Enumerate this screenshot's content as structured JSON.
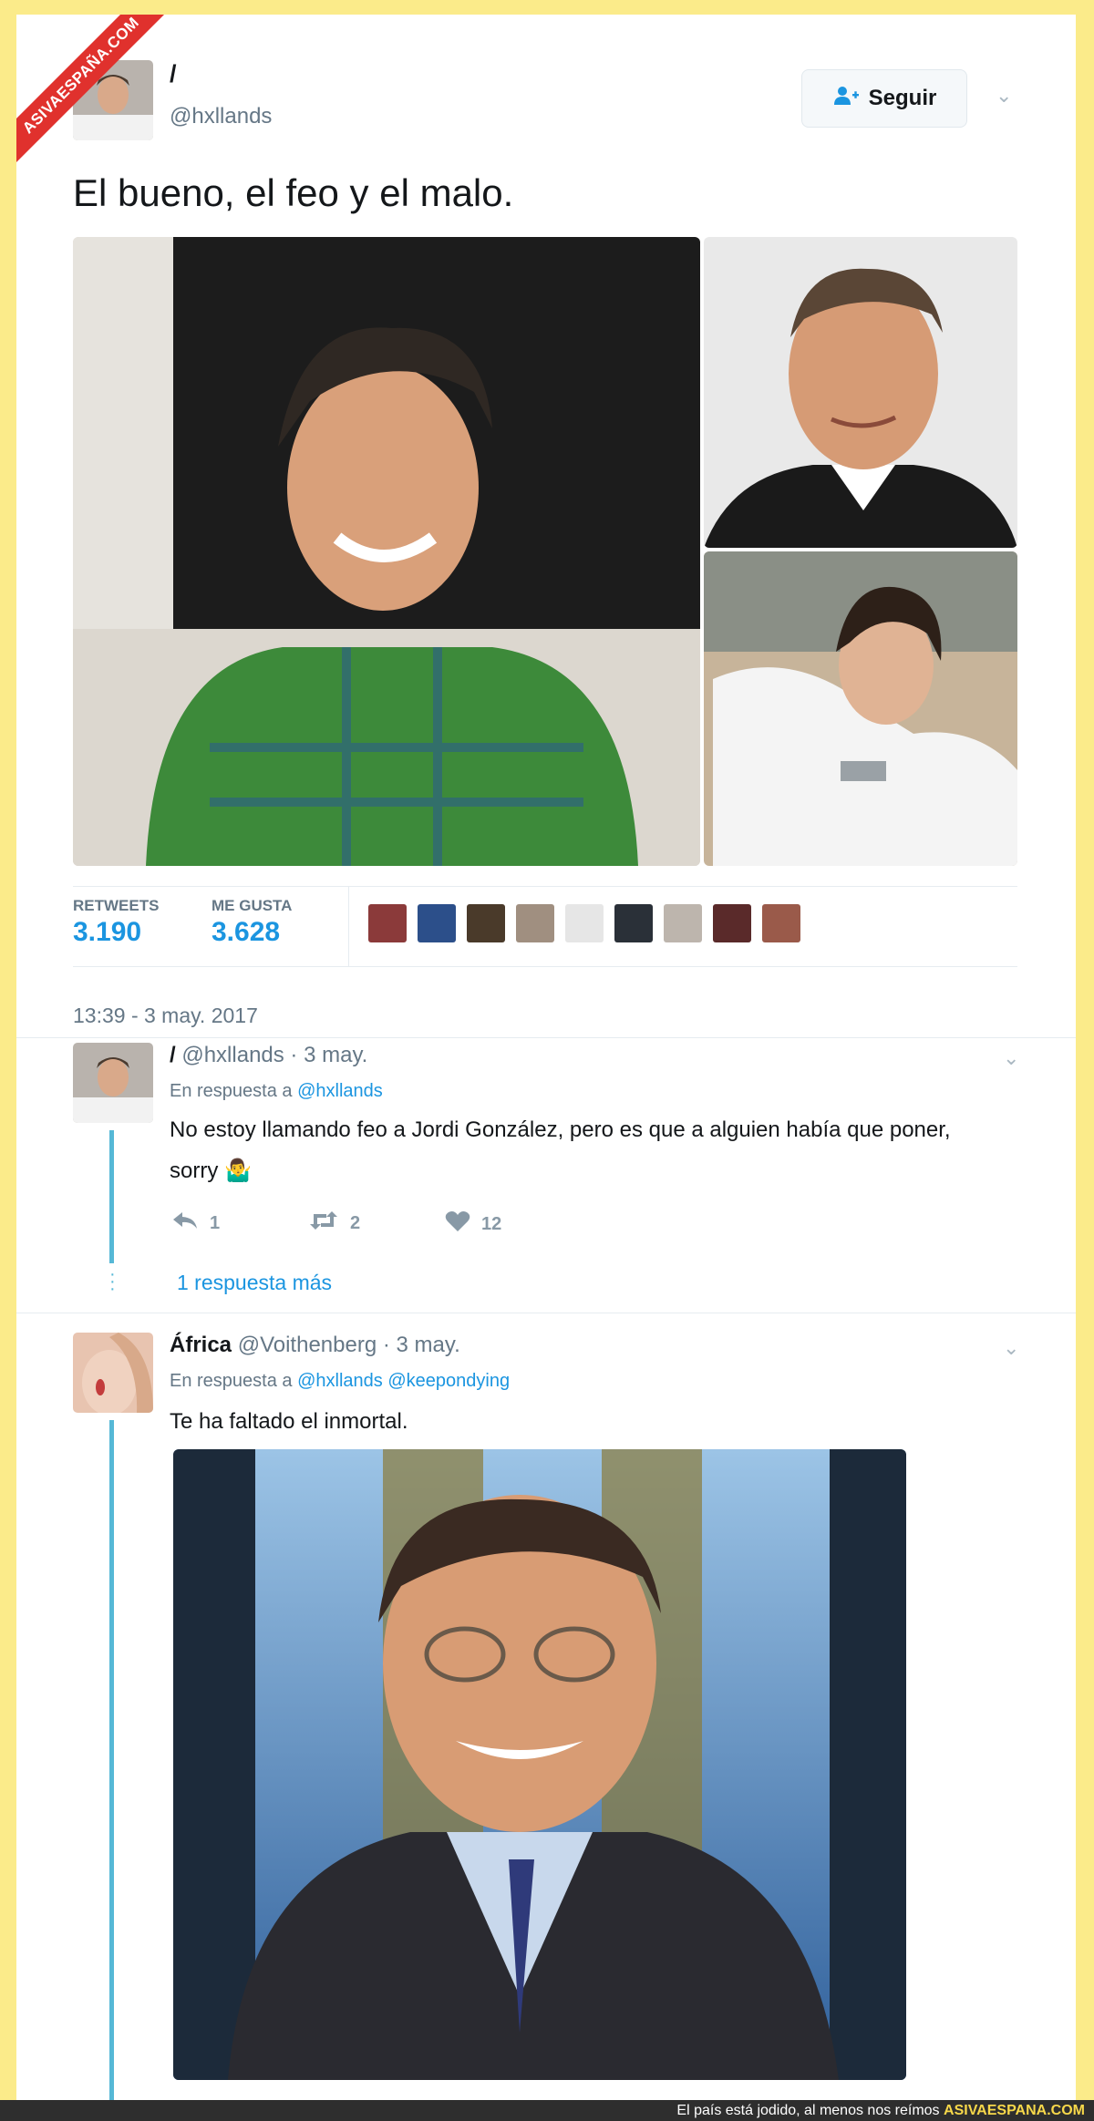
{
  "watermark": "ASIVAESPAÑA.COM",
  "tweet": {
    "name": "/",
    "handle": "@hxllands",
    "follow_label": "Seguir",
    "text": "El bueno, el feo y el malo.",
    "stats": {
      "retweets_label": "RETWEETS",
      "retweets_value": "3.190",
      "likes_label": "ME GUSTA",
      "likes_value": "3.628"
    },
    "timestamp": "13:39 - 3 may. 2017"
  },
  "reply1": {
    "name": "/",
    "handle_date": "@hxllands · 3 may.",
    "reply_prefix": "En respuesta a",
    "reply_to": "@hxllands",
    "text_line1": "No estoy llamando feo a Jordi González, pero es que a alguien había que poner,",
    "text_line2": "sorry 🤷‍♂️",
    "reply_count": "1",
    "retweet_count": "2",
    "like_count": "12",
    "more_replies": "1 respuesta más"
  },
  "reply2": {
    "name": "África",
    "handle_date": "@Voithenberg · 3 may.",
    "reply_prefix": "En respuesta a",
    "reply_to": "@hxllands @keepondying",
    "text": "Te ha faltado el inmortal."
  },
  "footer": {
    "text": "El país está jodido, al menos nos reímos",
    "brand": "ASIVAESPANA.COM"
  },
  "colors": {
    "border_yellow": "#fbeb8a",
    "link_blue": "#1b95e0",
    "thread_line": "#56b8d6",
    "ribbon_red": "#e0312d"
  }
}
